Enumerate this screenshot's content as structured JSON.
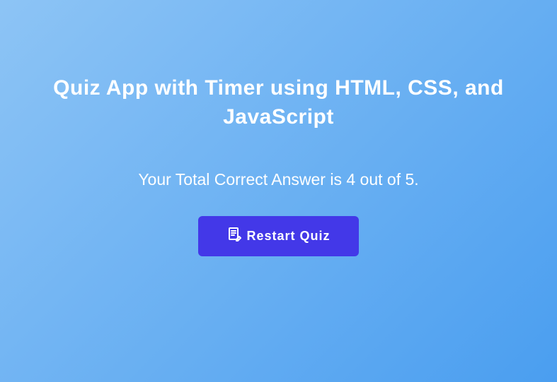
{
  "title": "Quiz App with Timer using HTML, CSS, and JavaScript",
  "result": {
    "text": "Your Total Correct Answer is 4 out of 5."
  },
  "button": {
    "restart_label": "Restart Quiz"
  }
}
